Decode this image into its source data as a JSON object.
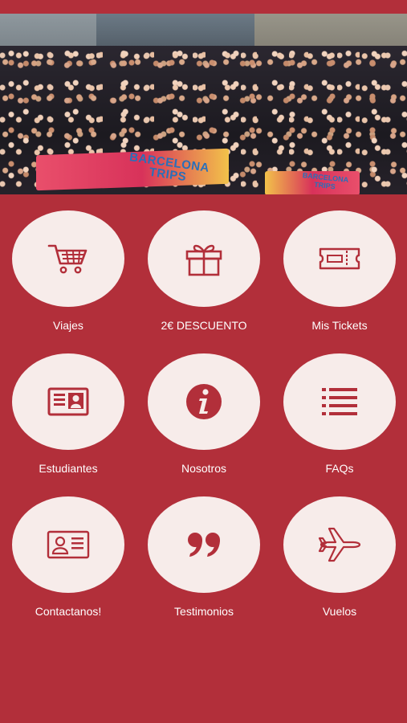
{
  "hero": {
    "banner_main": "BARCELONA TRIPS",
    "banner_small": "BARCELONA TRIPS"
  },
  "menu": [
    {
      "label": "Viajes",
      "icon": "shopping-cart-icon"
    },
    {
      "label": "2€ DESCUENTO",
      "icon": "gift-icon"
    },
    {
      "label": "Mis Tickets",
      "icon": "ticket-icon"
    },
    {
      "label": "Estudiantes",
      "icon": "id-card-icon"
    },
    {
      "label": "Nosotros",
      "icon": "info-icon"
    },
    {
      "label": "FAQs",
      "icon": "list-icon"
    },
    {
      "label": "Contactanos!",
      "icon": "contact-card-icon"
    },
    {
      "label": "Testimonios",
      "icon": "quote-icon"
    },
    {
      "label": "Vuelos",
      "icon": "airplane-icon"
    }
  ],
  "colors": {
    "background": "#b22f3a",
    "circle": "#f7ecea",
    "icon": "#b22f3a",
    "label": "#ffffff"
  }
}
